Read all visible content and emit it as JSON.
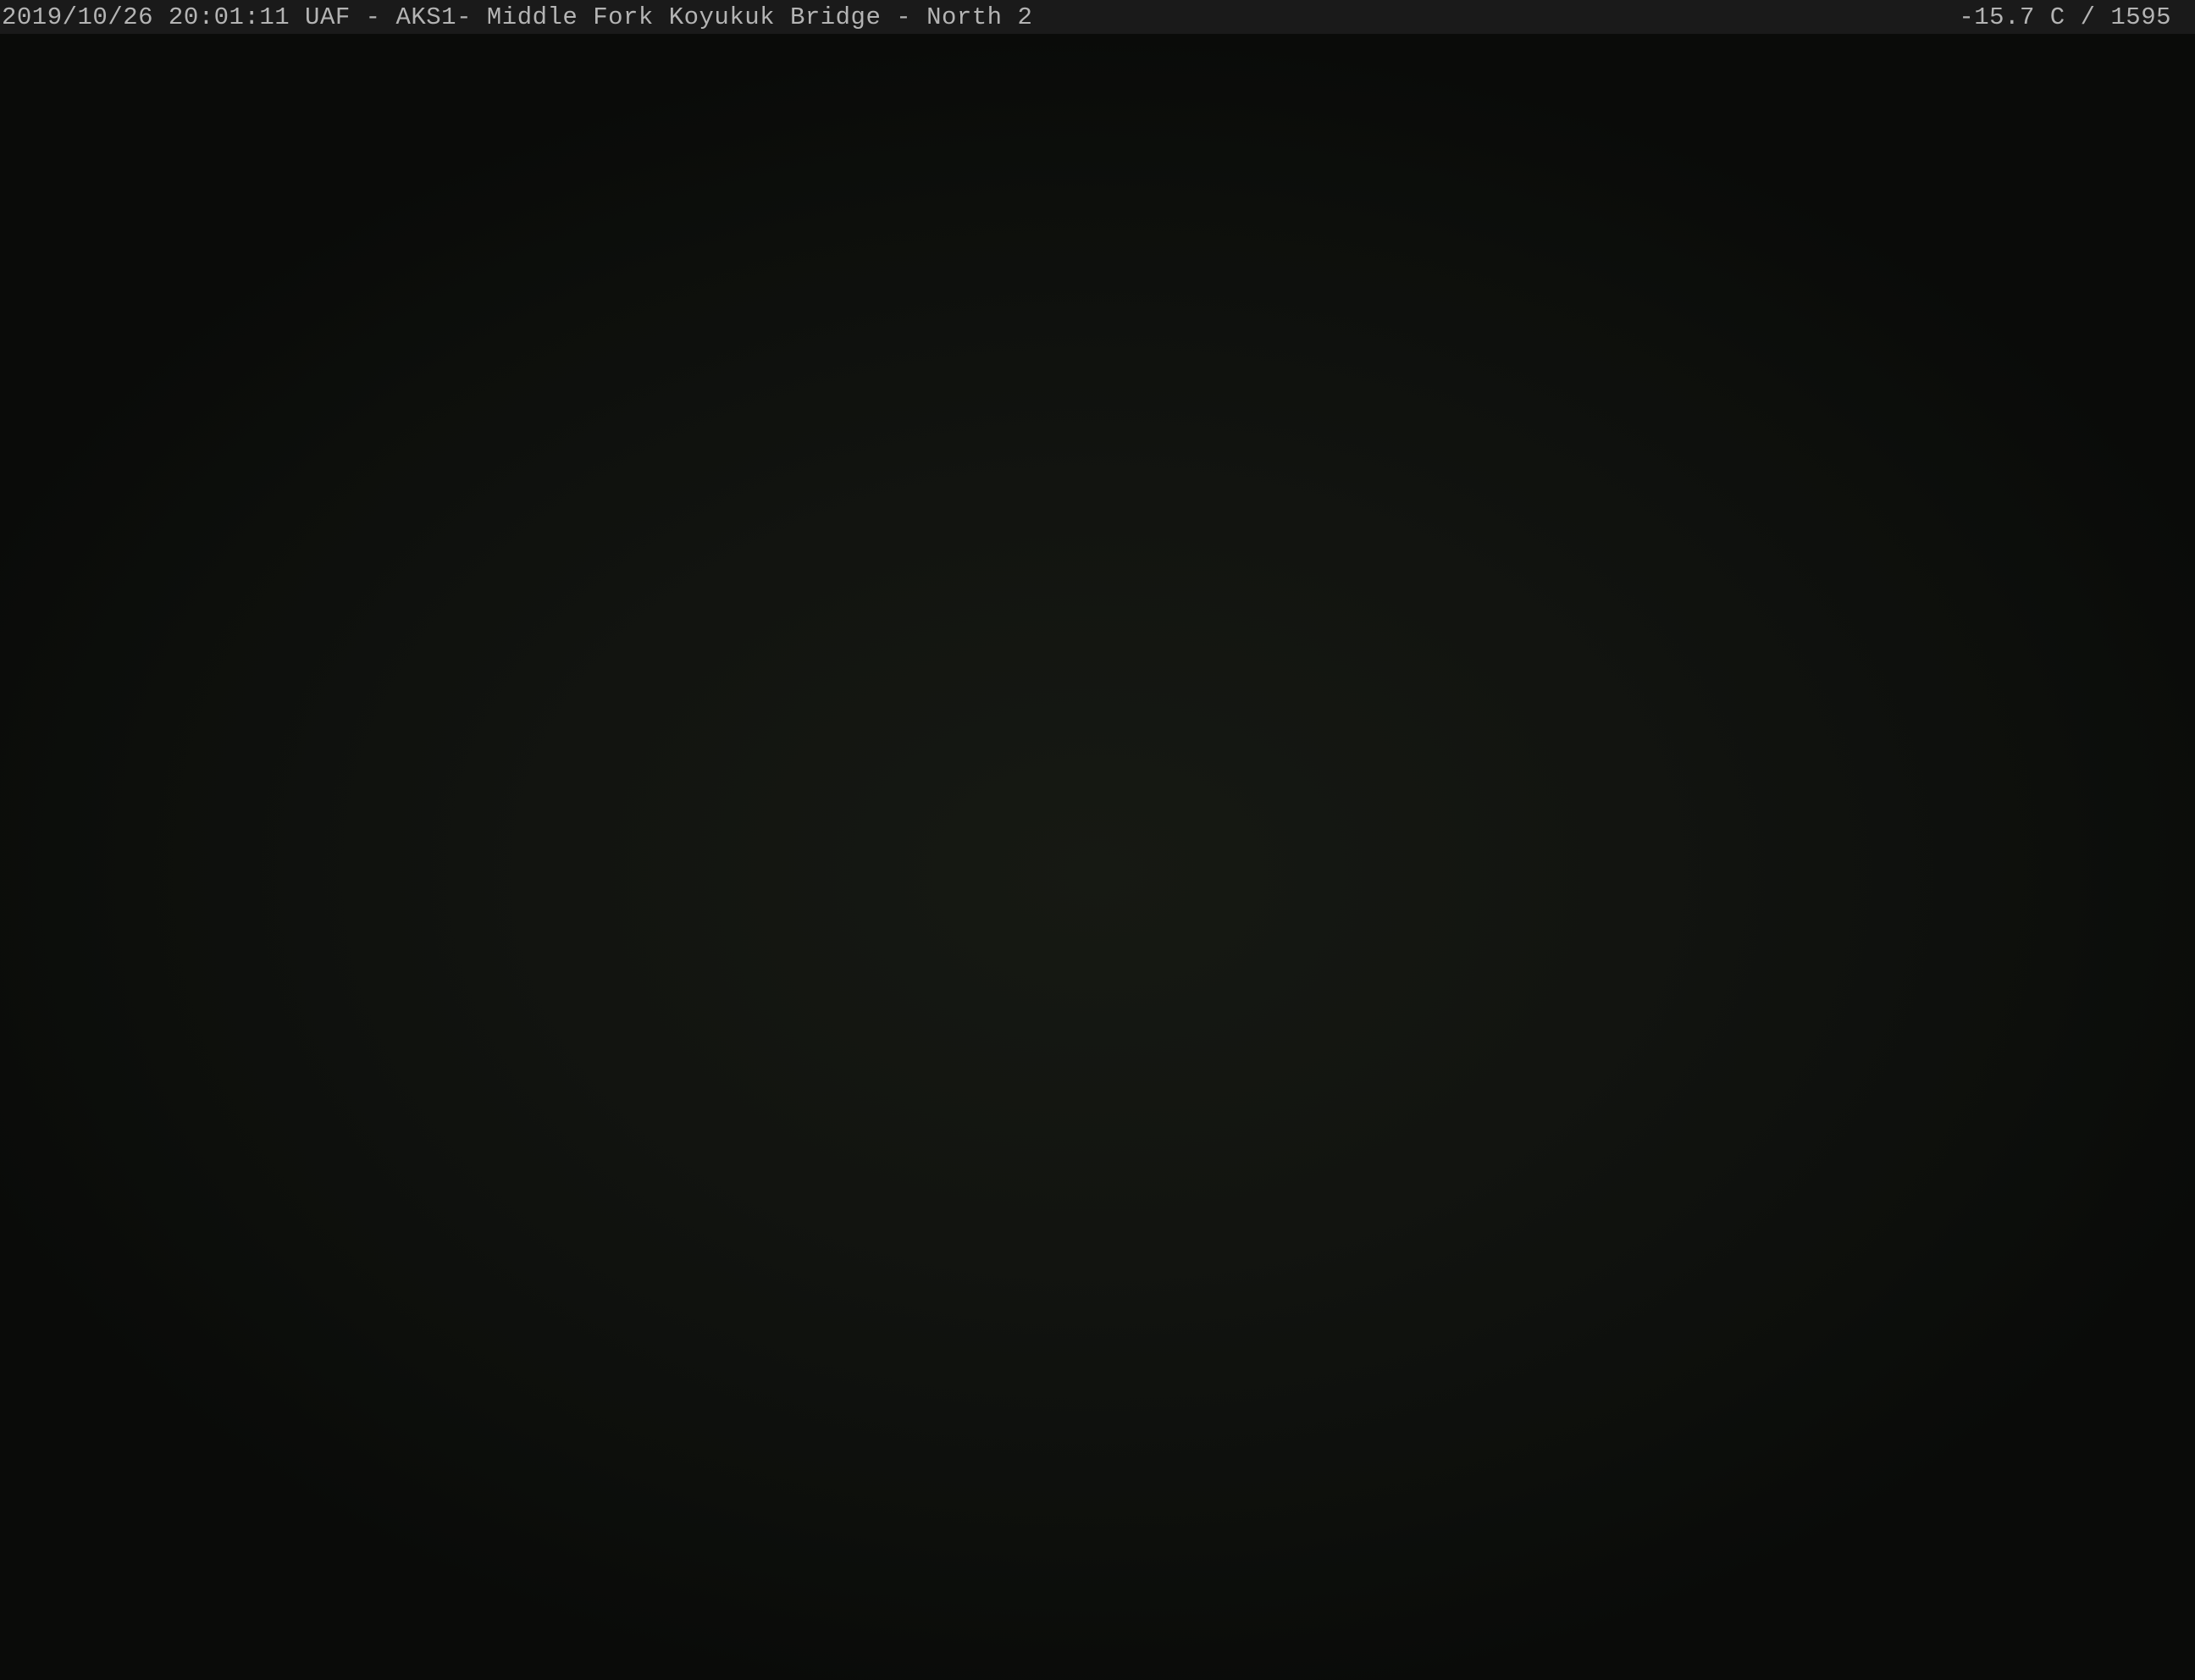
{
  "overlay": {
    "left_text": "2019/10/26 20:01:11 UAF - AKS1- Middle Fork Koyukuk Bridge - North 2",
    "right_text": "-15.7 C / 1595"
  },
  "colors": {
    "overlay_background": "#1a1a1a",
    "overlay_text": "#b4b4b4",
    "scene_dark": "#0d0f0c"
  }
}
